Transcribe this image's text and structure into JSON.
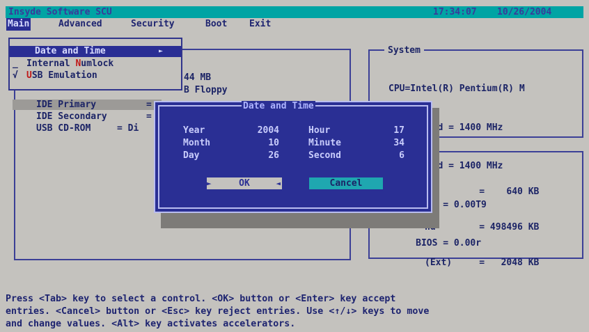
{
  "title_bar": {
    "app_name": "Insyde Software SCU",
    "time": "17:34:07",
    "date": "10/26/2004"
  },
  "menu": {
    "items": [
      "Main",
      "Advanced",
      "Security",
      "Boot",
      "Exit"
    ]
  },
  "dropdown": {
    "items": [
      {
        "label": "Date and Time",
        "arrow": "►",
        "check": ""
      },
      {
        "label_pre": "Internal ",
        "label_hot": "N",
        "label_post": "umlock",
        "check": ""
      },
      {
        "label_hot": "U",
        "label_post": "SB Emulation",
        "check": "√"
      }
    ]
  },
  "left_panel": {
    "partial_mem": "44 MB",
    "partial_floppy": "B Floppy",
    "rows": [
      {
        "label": "IDE Primary",
        "sep": "="
      },
      {
        "label": "IDE Secondary",
        "sep": "="
      },
      {
        "label": "USB CD-ROM",
        "sep": "= Di"
      }
    ]
  },
  "system_panel": {
    "title": "System",
    "lines": [
      "CPU=Intel(R) Pentium(R) M",
      "MAX  Speed = 1400 MHz",
      "CPU  Speed = 1400 MHz",
      "     BIOS = 0.00T9",
      "     BIOS = 0.00r"
    ]
  },
  "memory_panel": {
    "lines": [
      "          =    640 KB",
      "nd        = 498496 KB",
      "(Ext)     =   2048 KB"
    ]
  },
  "dialog": {
    "title": "Date and Time",
    "fields": {
      "year_label": "Year",
      "year_value": "2004",
      "month_label": "Month",
      "month_value": "10",
      "day_label": "Day",
      "day_value": "26",
      "hour_label": "Hour",
      "hour_value": "17",
      "minute_label": "Minute",
      "minute_value": "34",
      "second_label": "Second",
      "second_value": "6"
    },
    "ok_label": "OK",
    "ok_left_marker": "►",
    "ok_right_marker": "◄",
    "cancel_label": "Cancel"
  },
  "help_text": {
    "line1": "Press <Tab> key to select a control. <OK> button or <Enter> key accept",
    "line2": "entries. <Cancel> button or <Esc> key reject entries. Use <↑/↓> keys to move",
    "line3": "and change values. <Alt> key activates accelerators."
  }
}
